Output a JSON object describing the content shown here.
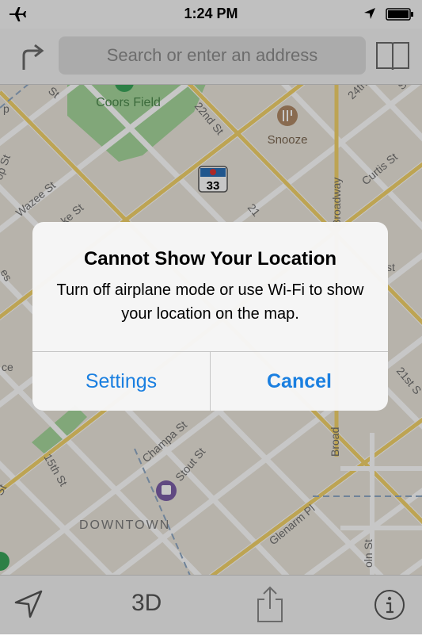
{
  "status_bar": {
    "time": "1:24 PM"
  },
  "top_bar": {
    "search_placeholder": "Search or enter an address"
  },
  "map": {
    "labels": {
      "coors_field": "Coors Field",
      "snooze": "Snooze",
      "downtown": "DOWNTOWN",
      "route_33": "33",
      "st_22nd": "22nd St",
      "st_24th": "24th St",
      "curtis": "Curtis St",
      "broadway_top": "Broadway",
      "broadway_bottom": "Broad",
      "wazee": "Wazee St",
      "ke": "ke St",
      "op": "op St",
      "st_21_mid": "21",
      "st_21st": "21st S",
      "champa": "Champa St",
      "stout": "Stout St",
      "st_15th": "15th St",
      "glenarm": "Glenarm Pl",
      "lincoln": "oln St",
      "st_top_left": "St",
      "st_top_right": "St",
      "ce": "ce",
      "es": "es",
      "st_left": "St",
      "st_right": "st",
      "p_left": "p"
    }
  },
  "alert": {
    "title": "Cannot Show Your Location",
    "message": "Turn off airplane mode or use Wi-Fi to show your location on the map.",
    "buttons": {
      "settings": "Settings",
      "cancel": "Cancel"
    }
  },
  "bottom_bar": {
    "view_3d": "3D"
  },
  "colors": {
    "accent": "#1a7fe0",
    "park": "#a6d69b",
    "road_major": "#f3d36b",
    "light_rail": "#7b5ea7"
  }
}
